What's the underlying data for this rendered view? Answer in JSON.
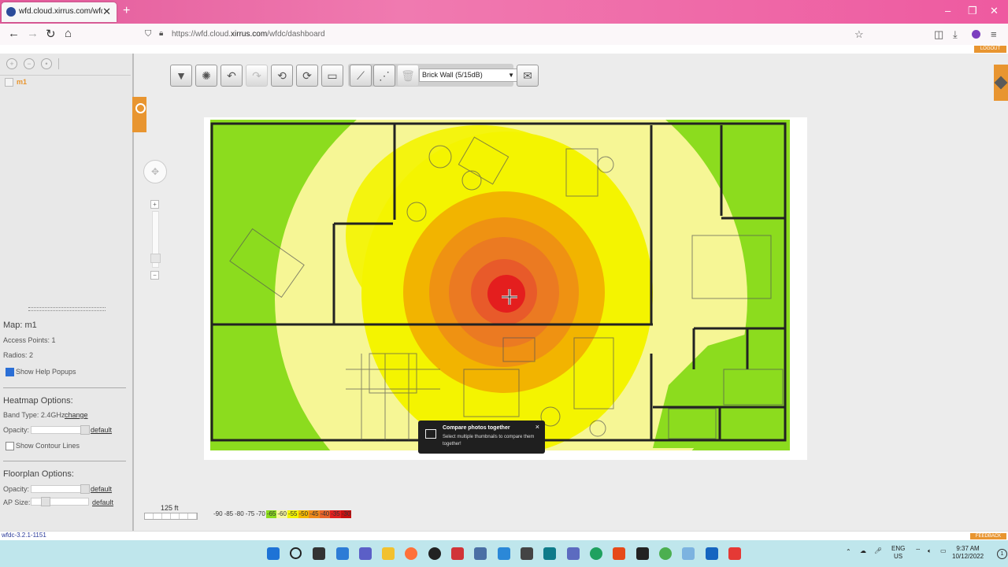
{
  "browser": {
    "tab_title": "wfd.cloud.xirrus.com/wfdc/da",
    "url_prefix": "https://wfd.cloud.",
    "url_host": "xirrus.com",
    "url_path": "/wfdc/dashboard"
  },
  "app": {
    "logout_label": "LOGOUT",
    "feedback_label": "FEEDBACK",
    "version": "wfdc-3.2.1-1151"
  },
  "tree": {
    "item": "m1"
  },
  "map_info": {
    "map_label": "Map: m1",
    "access_points": "Access Points: 1",
    "radios": "Radios: 2",
    "show_help": "Show Help Popups",
    "show_help_checked": true
  },
  "heatmap_options": {
    "title": "Heatmap Options:",
    "band_label": "Band Type: 2.4GHz",
    "change_label": "change",
    "opacity_label": "Opacity:",
    "default_label": "default",
    "contour_label": "Show Contour Lines",
    "contour_checked": false
  },
  "floorplan_options": {
    "title": "Floorplan Options:",
    "opacity_label": "Opacity:",
    "default_label": "default",
    "ap_size_label": "AP Size:",
    "ap_default_label": "default"
  },
  "toolbar": {
    "wall_select": "Brick Wall (5/15dB)",
    "icons": [
      "save-icon",
      "settings-icon",
      "undo-icon",
      "redo-icon",
      "rotate-add-icon",
      "rotate-icon",
      "ruler-icon",
      "draw-wall-icon",
      "draw-polyline-icon",
      "delete-icon",
      "email-icon"
    ]
  },
  "scale": {
    "label": "125 ft"
  },
  "legend": [
    {
      "label": "-90",
      "color": "#ececec"
    },
    {
      "label": "-85",
      "color": "#ececec"
    },
    {
      "label": "-80",
      "color": "#ececec"
    },
    {
      "label": "-75",
      "color": "#ececec"
    },
    {
      "label": "-70",
      "color": "#ececec"
    },
    {
      "label": "-65",
      "color": "#8cdc1e"
    },
    {
      "label": "-60",
      "color": "#f7f7a0"
    },
    {
      "label": "-55",
      "color": "#f4f400"
    },
    {
      "label": "-50",
      "color": "#f4b800"
    },
    {
      "label": "-45",
      "color": "#ef8a1a"
    },
    {
      "label": "-40",
      "color": "#e8642a"
    },
    {
      "label": "-35",
      "color": "#e02020"
    },
    {
      "label": "-30",
      "color": "#c81010"
    }
  ],
  "toast": {
    "title": "Compare photos together",
    "body": "Select multiple thumbnails to compare them together!",
    "close": "×"
  },
  "system": {
    "lang1": "ENG",
    "lang2": "US",
    "time": "9:37 AM",
    "date": "10/12/2022"
  }
}
